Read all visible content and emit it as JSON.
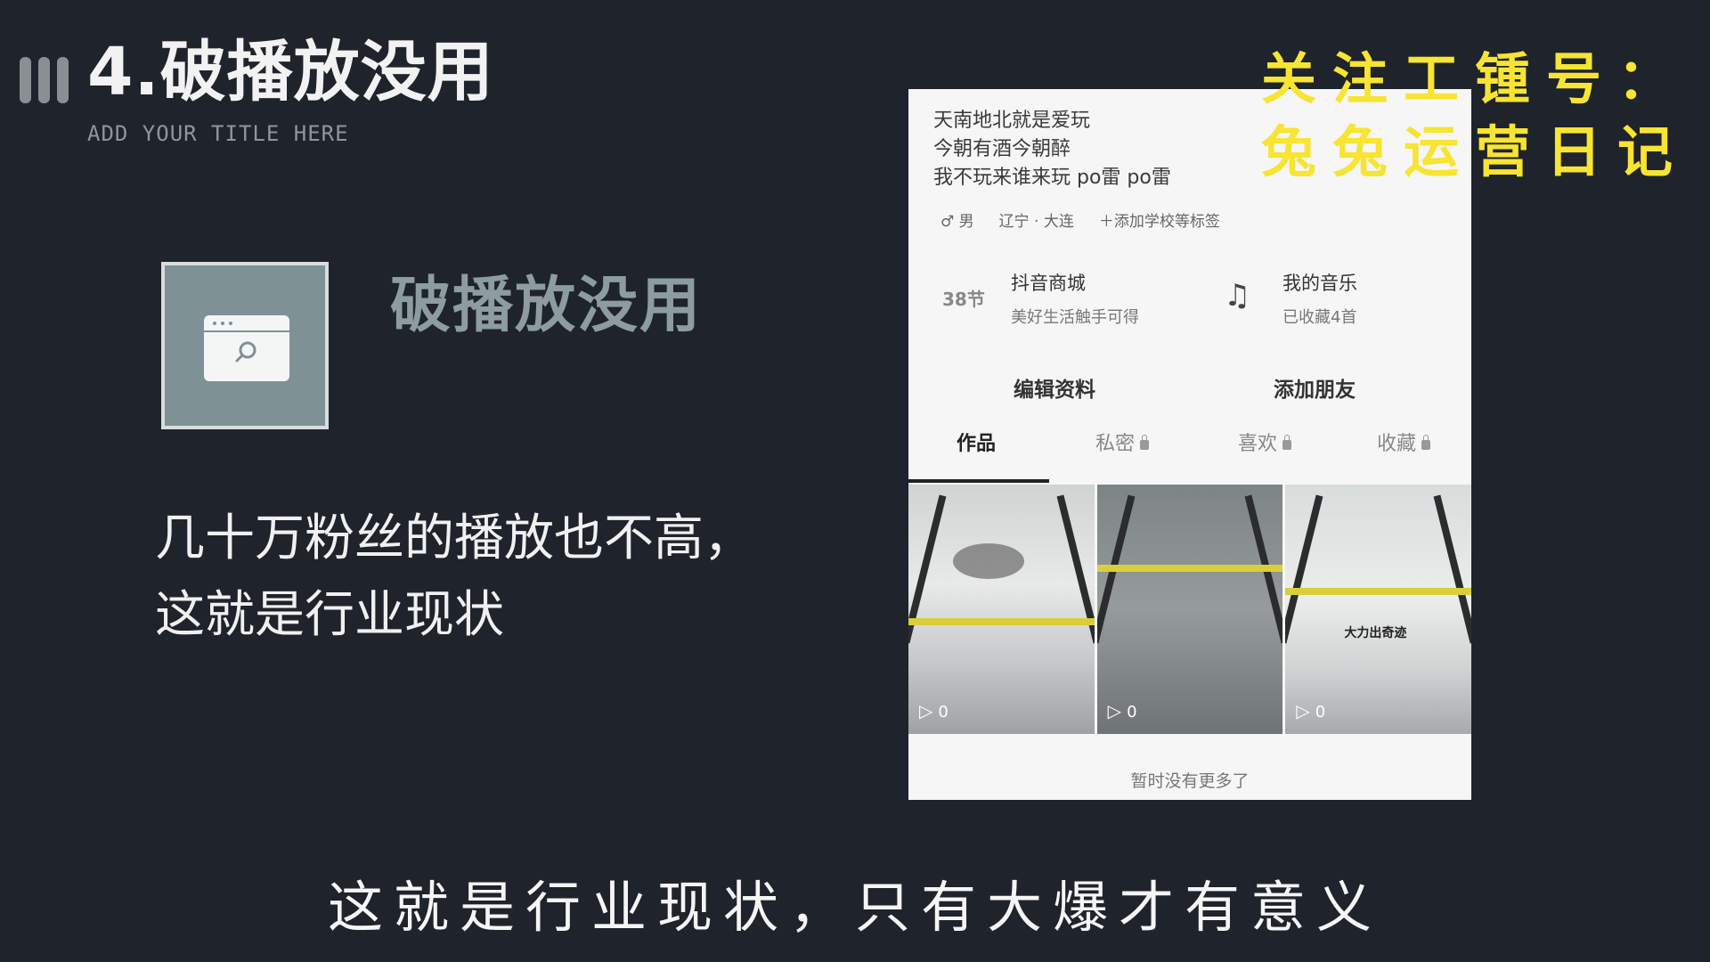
{
  "slide": {
    "title": "4.破播放没用",
    "subtitle": "ADD YOUR TITLE HERE",
    "heading": "破播放没用",
    "body_lines": [
      "几十万粉丝的播放也不高，",
      "这就是行业现状"
    ],
    "icon": "browser-search-icon"
  },
  "watermark": {
    "line1": "关注工锺号：",
    "line2": "兔兔运营日记"
  },
  "caption": "这就是行业现状，只有大爆才有意义",
  "phone": {
    "bio_lines": [
      "天南地北就是爱玩",
      "今朝有酒今朝醉",
      "我不玩来谁来玩 po雷 po雷"
    ],
    "meta": {
      "gender": "♂ 男",
      "location": "辽宁 · 大连",
      "add_school": "＋添加学校等标签"
    },
    "shop": {
      "icon_text": "38节",
      "label": "抖音商城",
      "sub": "美好生活触手可得"
    },
    "music": {
      "label": "我的音乐",
      "sub": "已收藏4首"
    },
    "buttons": {
      "edit": "编辑资料",
      "add_friend": "添加朋友"
    },
    "tabs": [
      "作品",
      "私密",
      "喜欢",
      "收藏"
    ],
    "videos": [
      {
        "plays": "0"
      },
      {
        "plays": "0"
      },
      {
        "plays": "0",
        "caption": "大力出奇迹"
      }
    ],
    "no_more": "暂时没有更多了"
  },
  "colors": {
    "background": "#1f232b",
    "watermark": "#f7e433",
    "icon_box": "#7e9295"
  }
}
